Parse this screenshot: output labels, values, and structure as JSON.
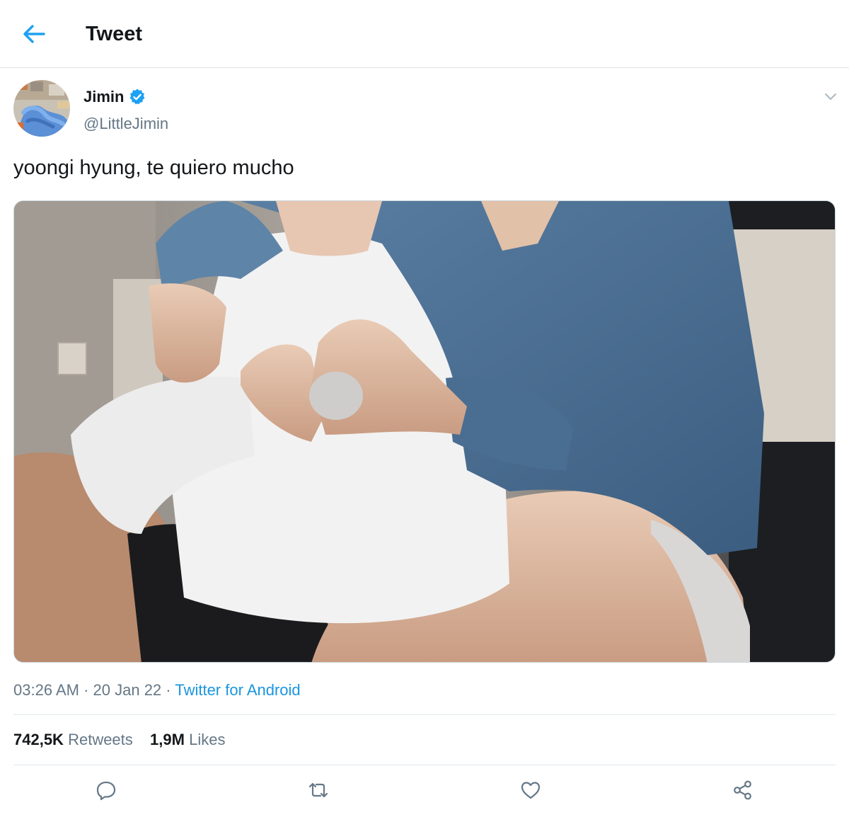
{
  "header": {
    "title": "Tweet",
    "back_icon": "arrow-left-icon",
    "accent_color": "#1da1f2"
  },
  "tweet": {
    "author": {
      "display_name": "Jimin",
      "handle": "@LittleJimin",
      "verified_icon": "verified-badge-icon"
    },
    "text": "yoongi hyung, te quiero mucho",
    "media_description_icon": "photo",
    "time": "03:26 AM",
    "date": "20 Jan 22",
    "source": "Twitter for Android",
    "separator": "·",
    "stats": {
      "retweets_count": "742,5K",
      "retweets_label": "Retweets",
      "likes_count": "1,9M",
      "likes_label": "Likes"
    },
    "actions": [
      "reply-icon",
      "retweet-icon",
      "like-icon",
      "share-icon"
    ]
  },
  "colors": {
    "text_primary": "#14171a",
    "text_secondary": "#657786",
    "link": "#1b95e0",
    "divider": "#e1e8ed"
  }
}
